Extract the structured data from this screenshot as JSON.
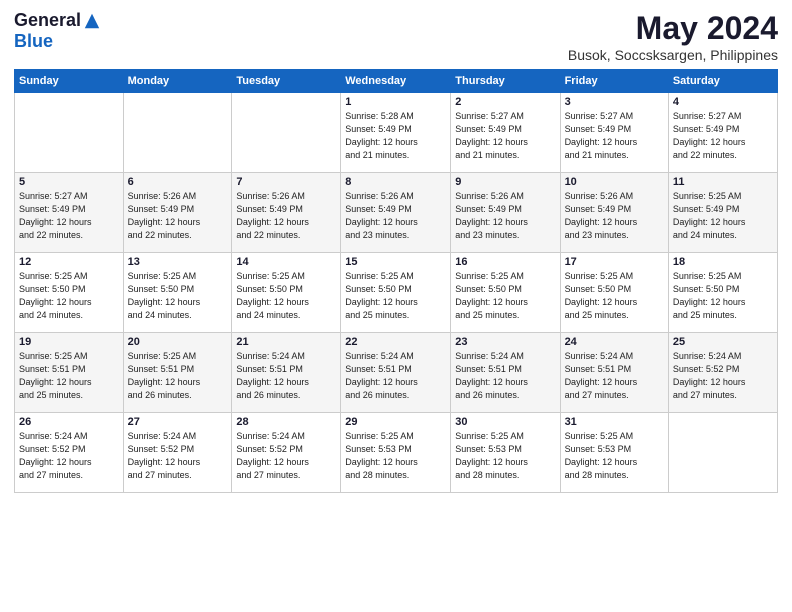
{
  "logo": {
    "general": "General",
    "blue": "Blue"
  },
  "title": "May 2024",
  "location": "Busok, Soccsksargen, Philippines",
  "headers": [
    "Sunday",
    "Monday",
    "Tuesday",
    "Wednesday",
    "Thursday",
    "Friday",
    "Saturday"
  ],
  "weeks": [
    [
      {
        "day": "",
        "info": ""
      },
      {
        "day": "",
        "info": ""
      },
      {
        "day": "",
        "info": ""
      },
      {
        "day": "1",
        "info": "Sunrise: 5:28 AM\nSunset: 5:49 PM\nDaylight: 12 hours\nand 21 minutes."
      },
      {
        "day": "2",
        "info": "Sunrise: 5:27 AM\nSunset: 5:49 PM\nDaylight: 12 hours\nand 21 minutes."
      },
      {
        "day": "3",
        "info": "Sunrise: 5:27 AM\nSunset: 5:49 PM\nDaylight: 12 hours\nand 21 minutes."
      },
      {
        "day": "4",
        "info": "Sunrise: 5:27 AM\nSunset: 5:49 PM\nDaylight: 12 hours\nand 22 minutes."
      }
    ],
    [
      {
        "day": "5",
        "info": "Sunrise: 5:27 AM\nSunset: 5:49 PM\nDaylight: 12 hours\nand 22 minutes."
      },
      {
        "day": "6",
        "info": "Sunrise: 5:26 AM\nSunset: 5:49 PM\nDaylight: 12 hours\nand 22 minutes."
      },
      {
        "day": "7",
        "info": "Sunrise: 5:26 AM\nSunset: 5:49 PM\nDaylight: 12 hours\nand 22 minutes."
      },
      {
        "day": "8",
        "info": "Sunrise: 5:26 AM\nSunset: 5:49 PM\nDaylight: 12 hours\nand 23 minutes."
      },
      {
        "day": "9",
        "info": "Sunrise: 5:26 AM\nSunset: 5:49 PM\nDaylight: 12 hours\nand 23 minutes."
      },
      {
        "day": "10",
        "info": "Sunrise: 5:26 AM\nSunset: 5:49 PM\nDaylight: 12 hours\nand 23 minutes."
      },
      {
        "day": "11",
        "info": "Sunrise: 5:25 AM\nSunset: 5:49 PM\nDaylight: 12 hours\nand 24 minutes."
      }
    ],
    [
      {
        "day": "12",
        "info": "Sunrise: 5:25 AM\nSunset: 5:50 PM\nDaylight: 12 hours\nand 24 minutes."
      },
      {
        "day": "13",
        "info": "Sunrise: 5:25 AM\nSunset: 5:50 PM\nDaylight: 12 hours\nand 24 minutes."
      },
      {
        "day": "14",
        "info": "Sunrise: 5:25 AM\nSunset: 5:50 PM\nDaylight: 12 hours\nand 24 minutes."
      },
      {
        "day": "15",
        "info": "Sunrise: 5:25 AM\nSunset: 5:50 PM\nDaylight: 12 hours\nand 25 minutes."
      },
      {
        "day": "16",
        "info": "Sunrise: 5:25 AM\nSunset: 5:50 PM\nDaylight: 12 hours\nand 25 minutes."
      },
      {
        "day": "17",
        "info": "Sunrise: 5:25 AM\nSunset: 5:50 PM\nDaylight: 12 hours\nand 25 minutes."
      },
      {
        "day": "18",
        "info": "Sunrise: 5:25 AM\nSunset: 5:50 PM\nDaylight: 12 hours\nand 25 minutes."
      }
    ],
    [
      {
        "day": "19",
        "info": "Sunrise: 5:25 AM\nSunset: 5:51 PM\nDaylight: 12 hours\nand 25 minutes."
      },
      {
        "day": "20",
        "info": "Sunrise: 5:25 AM\nSunset: 5:51 PM\nDaylight: 12 hours\nand 26 minutes."
      },
      {
        "day": "21",
        "info": "Sunrise: 5:24 AM\nSunset: 5:51 PM\nDaylight: 12 hours\nand 26 minutes."
      },
      {
        "day": "22",
        "info": "Sunrise: 5:24 AM\nSunset: 5:51 PM\nDaylight: 12 hours\nand 26 minutes."
      },
      {
        "day": "23",
        "info": "Sunrise: 5:24 AM\nSunset: 5:51 PM\nDaylight: 12 hours\nand 26 minutes."
      },
      {
        "day": "24",
        "info": "Sunrise: 5:24 AM\nSunset: 5:51 PM\nDaylight: 12 hours\nand 27 minutes."
      },
      {
        "day": "25",
        "info": "Sunrise: 5:24 AM\nSunset: 5:52 PM\nDaylight: 12 hours\nand 27 minutes."
      }
    ],
    [
      {
        "day": "26",
        "info": "Sunrise: 5:24 AM\nSunset: 5:52 PM\nDaylight: 12 hours\nand 27 minutes."
      },
      {
        "day": "27",
        "info": "Sunrise: 5:24 AM\nSunset: 5:52 PM\nDaylight: 12 hours\nand 27 minutes."
      },
      {
        "day": "28",
        "info": "Sunrise: 5:24 AM\nSunset: 5:52 PM\nDaylight: 12 hours\nand 27 minutes."
      },
      {
        "day": "29",
        "info": "Sunrise: 5:25 AM\nSunset: 5:53 PM\nDaylight: 12 hours\nand 28 minutes."
      },
      {
        "day": "30",
        "info": "Sunrise: 5:25 AM\nSunset: 5:53 PM\nDaylight: 12 hours\nand 28 minutes."
      },
      {
        "day": "31",
        "info": "Sunrise: 5:25 AM\nSunset: 5:53 PM\nDaylight: 12 hours\nand 28 minutes."
      },
      {
        "day": "",
        "info": ""
      }
    ]
  ]
}
